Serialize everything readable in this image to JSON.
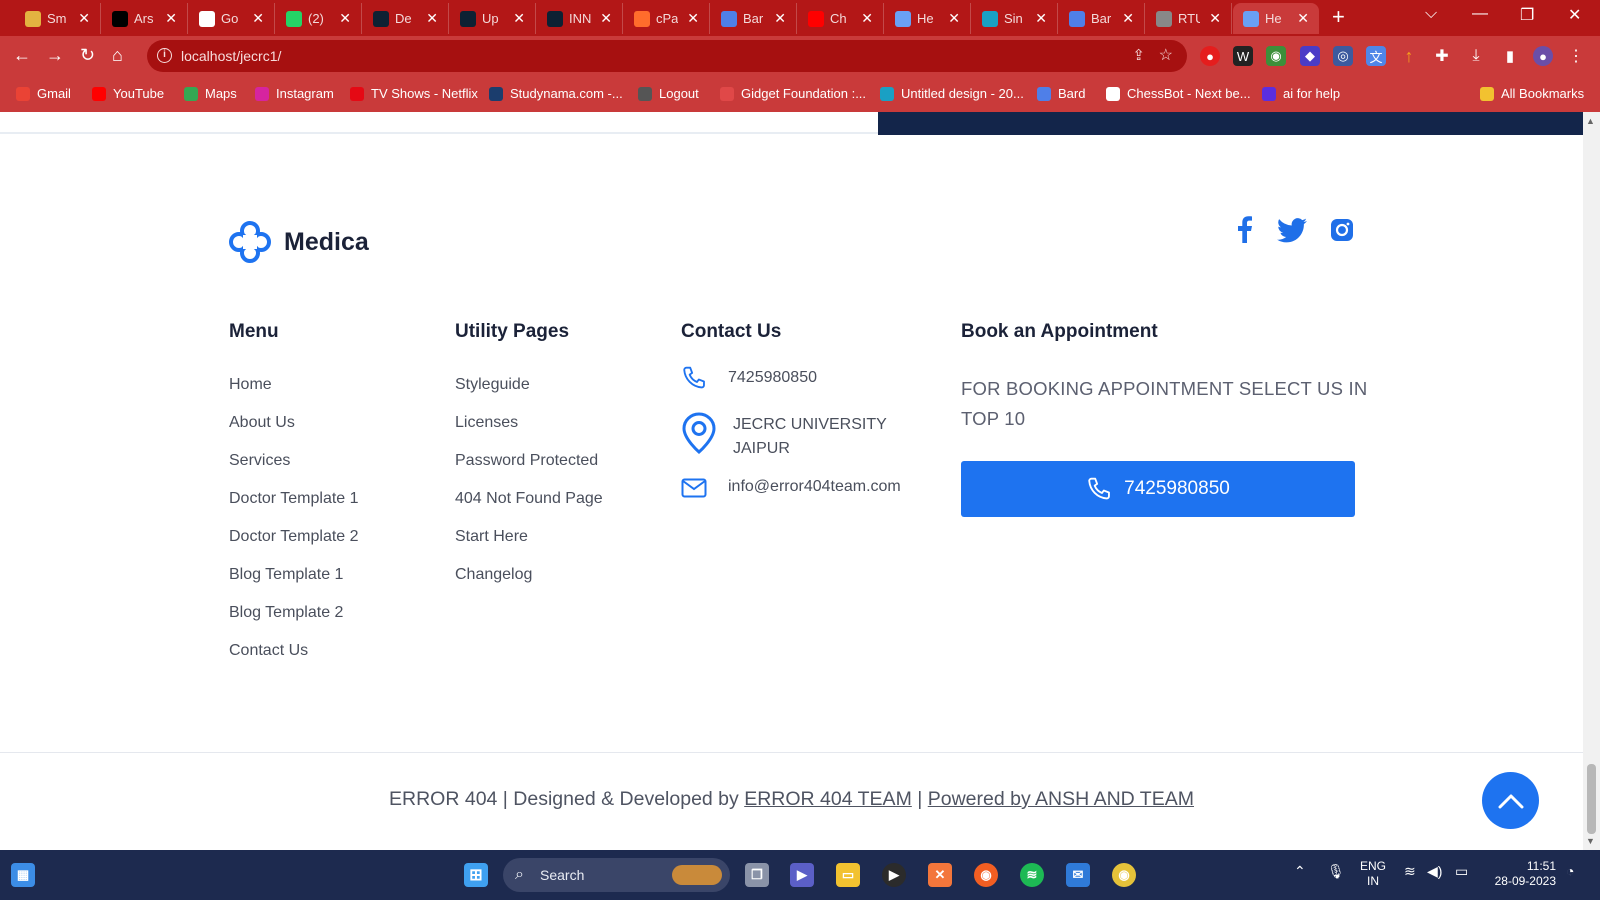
{
  "browser": {
    "tabs": [
      {
        "title": "Sm",
        "icon": "map-pin-icon",
        "color": "#e3b341"
      },
      {
        "title": "Ars",
        "icon": "x-logo-icon",
        "color": "#000000"
      },
      {
        "title": "Go",
        "icon": "google-icon",
        "color": "#ffffff"
      },
      {
        "title": "(2)",
        "icon": "whatsapp-icon",
        "color": "#25d366"
      },
      {
        "title": "De",
        "icon": "d-logo-icon",
        "color": "#0d2133"
      },
      {
        "title": "Up",
        "icon": "d-logo-icon",
        "color": "#0d2133"
      },
      {
        "title": "INN",
        "icon": "d-logo-icon",
        "color": "#0d2133"
      },
      {
        "title": "cPa",
        "icon": "cpanel-icon",
        "color": "#ff6c2c"
      },
      {
        "title": "Bar",
        "icon": "bard-icon",
        "color": "#4f7fe8"
      },
      {
        "title": "Ch",
        "icon": "youtube-icon",
        "color": "#ff0000"
      },
      {
        "title": "He",
        "icon": "medica-logo-icon",
        "color": "#6aa0f5"
      },
      {
        "title": "Sin",
        "icon": "canva-icon",
        "color": "#1aa0c4"
      },
      {
        "title": "Bar",
        "icon": "bard-icon",
        "color": "#4f7fe8"
      },
      {
        "title": "RTU",
        "icon": "globe-icon",
        "color": "#888888"
      },
      {
        "title": "He",
        "icon": "medica-logo-icon",
        "color": "#6aa0f5"
      }
    ],
    "address": "localhost/jecrc1/",
    "bookmarks": [
      {
        "label": "Gmail",
        "icon": "gmail-icon",
        "color": "#ea4335"
      },
      {
        "label": "YouTube",
        "icon": "youtube-icon",
        "color": "#ff0000"
      },
      {
        "label": "Maps",
        "icon": "maps-icon",
        "color": "#34a853"
      },
      {
        "label": "Instagram",
        "icon": "instagram-icon",
        "color": "#d6249f"
      },
      {
        "label": "TV Shows - Netflix",
        "icon": "netflix-icon",
        "color": "#e50914"
      },
      {
        "label": "Studynama.com -...",
        "icon": "studynama-icon",
        "color": "#1b3d6d"
      },
      {
        "label": "Logout",
        "icon": "globe-icon",
        "color": "#555555"
      },
      {
        "label": "Gidget Foundation :...",
        "icon": "gidget-icon",
        "color": "#e04848"
      },
      {
        "label": "Untitled design - 20...",
        "icon": "canva-icon",
        "color": "#1aa0c4"
      },
      {
        "label": "Bard",
        "icon": "bard-icon",
        "color": "#4f7fe8"
      },
      {
        "label": "ChessBot - Next be...",
        "icon": "chess-icon",
        "color": "#ffffff"
      },
      {
        "label": "ai for help",
        "icon": "c-logo-icon",
        "color": "#5b2ee0"
      }
    ],
    "all_bookmarks": "All Bookmarks"
  },
  "footer": {
    "brand": "Medica",
    "menu": {
      "heading": "Menu",
      "links": [
        "Home",
        "About Us",
        "Services",
        "Doctor Template 1",
        "Doctor Template 2",
        "Blog Template 1",
        "Blog Template 2",
        "Contact Us"
      ]
    },
    "utility": {
      "heading": "Utility Pages",
      "links": [
        "Styleguide",
        "Licenses",
        "Password Protected",
        "404 Not Found Page",
        "Start Here",
        "Changelog"
      ]
    },
    "contact": {
      "heading": "Contact Us",
      "phone": "7425980850",
      "address_line1": "JECRC UNIVERSITY",
      "address_line2": "JAIPUR",
      "email": "info@error404team.com"
    },
    "appointment": {
      "heading": "Book an Appointment",
      "text": "FOR BOOKING APPOINTMENT SELECT US IN TOP 10",
      "button_phone": "7425980850"
    },
    "copyright_prefix": "ERROR 404 | Designed & Developed by",
    "team_link": "ERROR 404 TEAM",
    "separator": "|",
    "powered_link": "Powered by ANSH AND TEAM"
  },
  "colors": {
    "accent": "#1e73f0",
    "dark": "#1b2238",
    "browser_red": "#b31717"
  },
  "taskbar": {
    "search_label": "Search",
    "lang_line1": "ENG",
    "lang_line2": "IN",
    "time": "11:51",
    "date": "28-09-2023"
  }
}
